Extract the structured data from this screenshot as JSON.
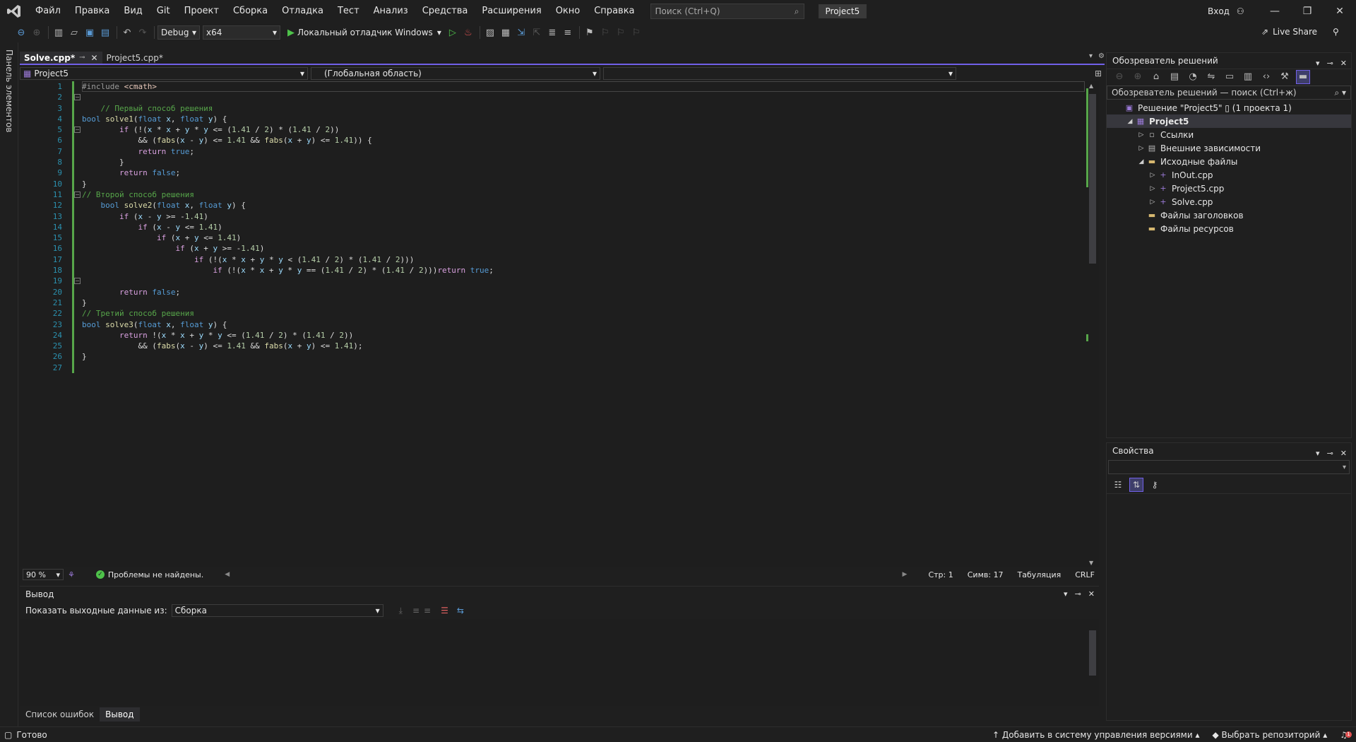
{
  "menu": {
    "items": [
      "Файл",
      "Правка",
      "Вид",
      "Git",
      "Проект",
      "Сборка",
      "Отладка",
      "Тест",
      "Анализ",
      "Средства",
      "Расширения",
      "Окно",
      "Справка"
    ],
    "search_placeholder": "Поиск (Ctrl+Q)",
    "solution_name": "Project5",
    "login": "Вход"
  },
  "toolbar": {
    "config": "Debug",
    "platform": "x64",
    "run_label": "Локальный отладчик Windows",
    "live_share": "Live Share"
  },
  "left_strip": {
    "label": "Панель элементов"
  },
  "doc_tabs": [
    {
      "label": "Solve.cpp*",
      "active": true
    },
    {
      "label": "Project5.cpp*",
      "active": false
    }
  ],
  "nav": {
    "project": "Project5",
    "scope": "(Глобальная область)"
  },
  "editor": {
    "lines": [
      [
        [
          "pp",
          "#include "
        ],
        [
          "str",
          "<cmath>"
        ]
      ],
      [],
      [
        [
          "cm",
          "    // Первый способ решения"
        ]
      ],
      [
        [
          "kw",
          "bool "
        ],
        [
          "fn",
          "solve1"
        ],
        [
          "p",
          "("
        ],
        [
          "kw",
          "float "
        ],
        [
          "var",
          "x"
        ],
        [
          "p",
          ", "
        ],
        [
          "kw",
          "float "
        ],
        [
          "var",
          "y"
        ],
        [
          "p",
          ") {"
        ]
      ],
      [
        [
          "p",
          "        "
        ],
        [
          "ctl",
          "if "
        ],
        [
          "p",
          "(!("
        ],
        [
          "var",
          "x"
        ],
        [
          "p",
          " * "
        ],
        [
          "var",
          "x"
        ],
        [
          "p",
          " + "
        ],
        [
          "var",
          "y"
        ],
        [
          "p",
          " * "
        ],
        [
          "var",
          "y"
        ],
        [
          "p",
          " <= ("
        ],
        [
          "num",
          "1.41"
        ],
        [
          "p",
          " / "
        ],
        [
          "num",
          "2"
        ],
        [
          "p",
          ") * ("
        ],
        [
          "num",
          "1.41"
        ],
        [
          "p",
          " / "
        ],
        [
          "num",
          "2"
        ],
        [
          "p",
          ")"
        ],
        [
          "p",
          ")"
        ]
      ],
      [
        [
          "p",
          "            && ("
        ],
        [
          "fn",
          "fabs"
        ],
        [
          "p",
          "("
        ],
        [
          "var",
          "x"
        ],
        [
          "p",
          " - "
        ],
        [
          "var",
          "y"
        ],
        [
          "p",
          ") <= "
        ],
        [
          "num",
          "1.41"
        ],
        [
          "p",
          " && "
        ],
        [
          "fn",
          "fabs"
        ],
        [
          "p",
          "("
        ],
        [
          "var",
          "x"
        ],
        [
          "p",
          " + "
        ],
        [
          "var",
          "y"
        ],
        [
          "p",
          ") <= "
        ],
        [
          "num",
          "1.41"
        ],
        [
          "p",
          ")) {"
        ]
      ],
      [
        [
          "p",
          "            "
        ],
        [
          "ctl",
          "return "
        ],
        [
          "kw",
          "true"
        ],
        [
          "p",
          ";"
        ]
      ],
      [
        [
          "p",
          "        }"
        ]
      ],
      [
        [
          "p",
          "        "
        ],
        [
          "ctl",
          "return "
        ],
        [
          "kw",
          "false"
        ],
        [
          "p",
          ";"
        ]
      ],
      [
        [
          "p",
          "}"
        ]
      ],
      [
        [
          "cm",
          "// Второй способ решения"
        ]
      ],
      [
        [
          "p",
          "    "
        ],
        [
          "kw",
          "bool "
        ],
        [
          "fn",
          "solve2"
        ],
        [
          "p",
          "("
        ],
        [
          "kw",
          "float "
        ],
        [
          "var",
          "x"
        ],
        [
          "p",
          ", "
        ],
        [
          "kw",
          "float "
        ],
        [
          "var",
          "y"
        ],
        [
          "p",
          ") {"
        ]
      ],
      [
        [
          "p",
          "        "
        ],
        [
          "ctl",
          "if "
        ],
        [
          "p",
          "("
        ],
        [
          "var",
          "x"
        ],
        [
          "p",
          " - "
        ],
        [
          "var",
          "y"
        ],
        [
          "p",
          " >= -"
        ],
        [
          "num",
          "1.41"
        ],
        [
          "p",
          ")"
        ]
      ],
      [
        [
          "p",
          "            "
        ],
        [
          "ctl",
          "if "
        ],
        [
          "p",
          "("
        ],
        [
          "var",
          "x"
        ],
        [
          "p",
          " - "
        ],
        [
          "var",
          "y"
        ],
        [
          "p",
          " <= "
        ],
        [
          "num",
          "1.41"
        ],
        [
          "p",
          ")"
        ]
      ],
      [
        [
          "p",
          "                "
        ],
        [
          "ctl",
          "if "
        ],
        [
          "p",
          "("
        ],
        [
          "var",
          "x"
        ],
        [
          "p",
          " + "
        ],
        [
          "var",
          "y"
        ],
        [
          "p",
          " <= "
        ],
        [
          "num",
          "1.41"
        ],
        [
          "p",
          ")"
        ]
      ],
      [
        [
          "p",
          "                    "
        ],
        [
          "ctl",
          "if "
        ],
        [
          "p",
          "("
        ],
        [
          "var",
          "x"
        ],
        [
          "p",
          " + "
        ],
        [
          "var",
          "y"
        ],
        [
          "p",
          " >= -"
        ],
        [
          "num",
          "1.41"
        ],
        [
          "p",
          ")"
        ]
      ],
      [
        [
          "p",
          "                        "
        ],
        [
          "ctl",
          "if "
        ],
        [
          "p",
          "(!("
        ],
        [
          "var",
          "x"
        ],
        [
          "p",
          " * "
        ],
        [
          "var",
          "x"
        ],
        [
          "p",
          " + "
        ],
        [
          "var",
          "y"
        ],
        [
          "p",
          " * "
        ],
        [
          "var",
          "y"
        ],
        [
          "p",
          " < ("
        ],
        [
          "num",
          "1.41"
        ],
        [
          "p",
          " / "
        ],
        [
          "num",
          "2"
        ],
        [
          "p",
          ") * ("
        ],
        [
          "num",
          "1.41"
        ],
        [
          "p",
          " / "
        ],
        [
          "num",
          "2"
        ],
        [
          "p",
          "))"
        ],
        [
          "p",
          ")"
        ]
      ],
      [
        [
          "p",
          "                            "
        ],
        [
          "ctl",
          "if "
        ],
        [
          "p",
          "(!("
        ],
        [
          "var",
          "x"
        ],
        [
          "p",
          " * "
        ],
        [
          "var",
          "x"
        ],
        [
          "p",
          " + "
        ],
        [
          "var",
          "y"
        ],
        [
          "p",
          " * "
        ],
        [
          "var",
          "y"
        ],
        [
          "p",
          " == ("
        ],
        [
          "num",
          "1.41"
        ],
        [
          "p",
          " / "
        ],
        [
          "num",
          "2"
        ],
        [
          "p",
          ") * ("
        ],
        [
          "num",
          "1.41"
        ],
        [
          "p",
          " / "
        ],
        [
          "num",
          "2"
        ],
        [
          "p",
          ")))"
        ],
        [
          "ctl",
          "return "
        ],
        [
          "kw",
          "true"
        ],
        [
          "p",
          ";"
        ]
      ],
      [],
      [
        [
          "p",
          "        "
        ],
        [
          "ctl",
          "return "
        ],
        [
          "kw",
          "false"
        ],
        [
          "p",
          ";"
        ]
      ],
      [
        [
          "p",
          "}"
        ]
      ],
      [
        [
          "cm",
          "// Третий способ решения"
        ]
      ],
      [
        [
          "kw",
          "bool "
        ],
        [
          "fn",
          "solve3"
        ],
        [
          "p",
          "("
        ],
        [
          "kw",
          "float "
        ],
        [
          "var",
          "x"
        ],
        [
          "p",
          ", "
        ],
        [
          "kw",
          "float "
        ],
        [
          "var",
          "y"
        ],
        [
          "p",
          ") {"
        ]
      ],
      [
        [
          "p",
          "        "
        ],
        [
          "ctl",
          "return "
        ],
        [
          "p",
          "!("
        ],
        [
          "var",
          "x"
        ],
        [
          "p",
          " * "
        ],
        [
          "var",
          "x"
        ],
        [
          "p",
          " + "
        ],
        [
          "var",
          "y"
        ],
        [
          "p",
          " * "
        ],
        [
          "var",
          "y"
        ],
        [
          "p",
          " <= ("
        ],
        [
          "num",
          "1.41"
        ],
        [
          "p",
          " / "
        ],
        [
          "num",
          "2"
        ],
        [
          "p",
          ") * ("
        ],
        [
          "num",
          "1.41"
        ],
        [
          "p",
          " / "
        ],
        [
          "num",
          "2"
        ],
        [
          "p",
          "))"
        ]
      ],
      [
        [
          "p",
          "            && ("
        ],
        [
          "fn",
          "fabs"
        ],
        [
          "p",
          "("
        ],
        [
          "var",
          "x"
        ],
        [
          "p",
          " - "
        ],
        [
          "var",
          "y"
        ],
        [
          "p",
          ") <= "
        ],
        [
          "num",
          "1.41"
        ],
        [
          "p",
          " && "
        ],
        [
          "fn",
          "fabs"
        ],
        [
          "p",
          "("
        ],
        [
          "var",
          "x"
        ],
        [
          "p",
          " + "
        ],
        [
          "var",
          "y"
        ],
        [
          "p",
          ") <= "
        ],
        [
          "num",
          "1.41"
        ],
        [
          "p",
          ");"
        ]
      ],
      [
        [
          "p",
          "}"
        ]
      ],
      []
    ]
  },
  "editor_status": {
    "zoom": "90 %",
    "issues": "Проблемы не найдены.",
    "line": "Стр: 1",
    "char": "Симв: 17",
    "indent": "Табуляция",
    "eol": "CRLF"
  },
  "output": {
    "title": "Вывод",
    "show_from_label": "Показать выходные данные из:",
    "source": "Сборка"
  },
  "bottom_tabs": [
    "Список ошибок",
    "Вывод"
  ],
  "solution_explorer": {
    "title": "Обозреватель решений",
    "search_placeholder": "Обозреватель решений — поиск (Ctrl+ж)",
    "tree": [
      {
        "label": "Решение \"Project5\" ▯ (1 проекта 1)",
        "indent": 0,
        "arrow": "",
        "icon": "solution-icon",
        "glyph": "▣"
      },
      {
        "label": "Project5",
        "indent": 1,
        "arrow": "◢",
        "icon": "project-icon",
        "glyph": "▦",
        "bold": true,
        "selected": true
      },
      {
        "label": "Ссылки",
        "indent": 2,
        "arrow": "▷",
        "icon": "references-icon",
        "glyph": "▫"
      },
      {
        "label": "Внешние зависимости",
        "indent": 2,
        "arrow": "▷",
        "icon": "dependencies-icon",
        "glyph": "▤"
      },
      {
        "label": "Исходные файлы",
        "indent": 2,
        "arrow": "◢",
        "icon": "folder-open-icon",
        "glyph": "▬"
      },
      {
        "label": "InOut.cpp",
        "indent": 3,
        "arrow": "▷",
        "icon": "cpp-file-icon",
        "glyph": "+"
      },
      {
        "label": "Project5.cpp",
        "indent": 3,
        "arrow": "▷",
        "icon": "cpp-file-icon",
        "glyph": "+"
      },
      {
        "label": "Solve.cpp",
        "indent": 3,
        "arrow": "▷",
        "icon": "cpp-file-icon",
        "glyph": "+"
      },
      {
        "label": "Файлы заголовков",
        "indent": 2,
        "arrow": "",
        "icon": "folder-icon",
        "glyph": "▬"
      },
      {
        "label": "Файлы ресурсов",
        "indent": 2,
        "arrow": "",
        "icon": "folder-icon",
        "glyph": "▬"
      }
    ]
  },
  "properties": {
    "title": "Свойства"
  },
  "statusbar": {
    "ready": "Готово",
    "add_vcs": "Добавить в систему управления версиями",
    "select_repo": "Выбрать репозиторий",
    "notifications": "1"
  },
  "colors": {
    "accent": "#7160e8",
    "change_bar": "#57a64a",
    "keyword": "#569cd6",
    "control": "#d8a0df",
    "function": "#dcdcaa",
    "number": "#b5cea8",
    "comment": "#57a64a",
    "variable": "#9cdcfe",
    "line_number": "#2b91af"
  }
}
